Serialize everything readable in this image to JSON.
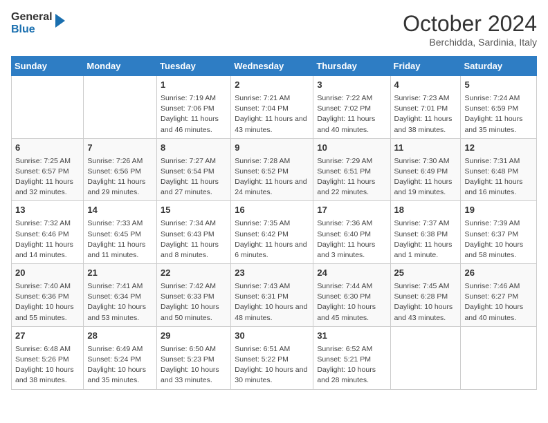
{
  "header": {
    "logo_line1": "General",
    "logo_line2": "Blue",
    "title": "October 2024",
    "subtitle": "Berchidda, Sardinia, Italy"
  },
  "days_of_week": [
    "Sunday",
    "Monday",
    "Tuesday",
    "Wednesday",
    "Thursday",
    "Friday",
    "Saturday"
  ],
  "weeks": [
    {
      "cells": [
        {
          "day": "",
          "content": ""
        },
        {
          "day": "",
          "content": ""
        },
        {
          "day": "1",
          "content": "Sunrise: 7:19 AM\nSunset: 7:06 PM\nDaylight: 11 hours and 46 minutes."
        },
        {
          "day": "2",
          "content": "Sunrise: 7:21 AM\nSunset: 7:04 PM\nDaylight: 11 hours and 43 minutes."
        },
        {
          "day": "3",
          "content": "Sunrise: 7:22 AM\nSunset: 7:02 PM\nDaylight: 11 hours and 40 minutes."
        },
        {
          "day": "4",
          "content": "Sunrise: 7:23 AM\nSunset: 7:01 PM\nDaylight: 11 hours and 38 minutes."
        },
        {
          "day": "5",
          "content": "Sunrise: 7:24 AM\nSunset: 6:59 PM\nDaylight: 11 hours and 35 minutes."
        }
      ]
    },
    {
      "cells": [
        {
          "day": "6",
          "content": "Sunrise: 7:25 AM\nSunset: 6:57 PM\nDaylight: 11 hours and 32 minutes."
        },
        {
          "day": "7",
          "content": "Sunrise: 7:26 AM\nSunset: 6:56 PM\nDaylight: 11 hours and 29 minutes."
        },
        {
          "day": "8",
          "content": "Sunrise: 7:27 AM\nSunset: 6:54 PM\nDaylight: 11 hours and 27 minutes."
        },
        {
          "day": "9",
          "content": "Sunrise: 7:28 AM\nSunset: 6:52 PM\nDaylight: 11 hours and 24 minutes."
        },
        {
          "day": "10",
          "content": "Sunrise: 7:29 AM\nSunset: 6:51 PM\nDaylight: 11 hours and 22 minutes."
        },
        {
          "day": "11",
          "content": "Sunrise: 7:30 AM\nSunset: 6:49 PM\nDaylight: 11 hours and 19 minutes."
        },
        {
          "day": "12",
          "content": "Sunrise: 7:31 AM\nSunset: 6:48 PM\nDaylight: 11 hours and 16 minutes."
        }
      ]
    },
    {
      "cells": [
        {
          "day": "13",
          "content": "Sunrise: 7:32 AM\nSunset: 6:46 PM\nDaylight: 11 hours and 14 minutes."
        },
        {
          "day": "14",
          "content": "Sunrise: 7:33 AM\nSunset: 6:45 PM\nDaylight: 11 hours and 11 minutes."
        },
        {
          "day": "15",
          "content": "Sunrise: 7:34 AM\nSunset: 6:43 PM\nDaylight: 11 hours and 8 minutes."
        },
        {
          "day": "16",
          "content": "Sunrise: 7:35 AM\nSunset: 6:42 PM\nDaylight: 11 hours and 6 minutes."
        },
        {
          "day": "17",
          "content": "Sunrise: 7:36 AM\nSunset: 6:40 PM\nDaylight: 11 hours and 3 minutes."
        },
        {
          "day": "18",
          "content": "Sunrise: 7:37 AM\nSunset: 6:38 PM\nDaylight: 11 hours and 1 minute."
        },
        {
          "day": "19",
          "content": "Sunrise: 7:39 AM\nSunset: 6:37 PM\nDaylight: 10 hours and 58 minutes."
        }
      ]
    },
    {
      "cells": [
        {
          "day": "20",
          "content": "Sunrise: 7:40 AM\nSunset: 6:36 PM\nDaylight: 10 hours and 55 minutes."
        },
        {
          "day": "21",
          "content": "Sunrise: 7:41 AM\nSunset: 6:34 PM\nDaylight: 10 hours and 53 minutes."
        },
        {
          "day": "22",
          "content": "Sunrise: 7:42 AM\nSunset: 6:33 PM\nDaylight: 10 hours and 50 minutes."
        },
        {
          "day": "23",
          "content": "Sunrise: 7:43 AM\nSunset: 6:31 PM\nDaylight: 10 hours and 48 minutes."
        },
        {
          "day": "24",
          "content": "Sunrise: 7:44 AM\nSunset: 6:30 PM\nDaylight: 10 hours and 45 minutes."
        },
        {
          "day": "25",
          "content": "Sunrise: 7:45 AM\nSunset: 6:28 PM\nDaylight: 10 hours and 43 minutes."
        },
        {
          "day": "26",
          "content": "Sunrise: 7:46 AM\nSunset: 6:27 PM\nDaylight: 10 hours and 40 minutes."
        }
      ]
    },
    {
      "cells": [
        {
          "day": "27",
          "content": "Sunrise: 6:48 AM\nSunset: 5:26 PM\nDaylight: 10 hours and 38 minutes."
        },
        {
          "day": "28",
          "content": "Sunrise: 6:49 AM\nSunset: 5:24 PM\nDaylight: 10 hours and 35 minutes."
        },
        {
          "day": "29",
          "content": "Sunrise: 6:50 AM\nSunset: 5:23 PM\nDaylight: 10 hours and 33 minutes."
        },
        {
          "day": "30",
          "content": "Sunrise: 6:51 AM\nSunset: 5:22 PM\nDaylight: 10 hours and 30 minutes."
        },
        {
          "day": "31",
          "content": "Sunrise: 6:52 AM\nSunset: 5:21 PM\nDaylight: 10 hours and 28 minutes."
        },
        {
          "day": "",
          "content": ""
        },
        {
          "day": "",
          "content": ""
        }
      ]
    }
  ]
}
